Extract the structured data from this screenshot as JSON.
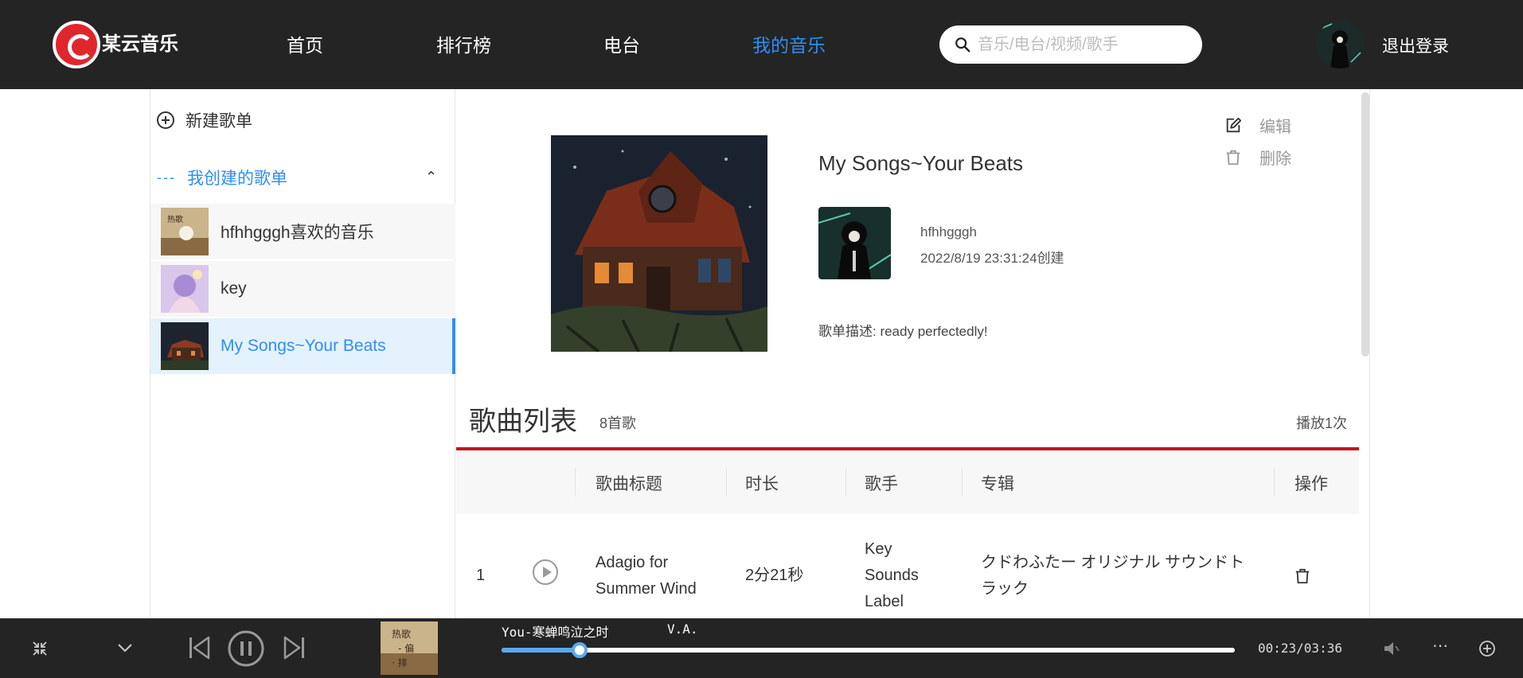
{
  "app": {
    "logo_text": "某云音乐"
  },
  "nav": [
    {
      "label": "首页",
      "active": false
    },
    {
      "label": "排行榜",
      "active": false
    },
    {
      "label": "电台",
      "active": false
    },
    {
      "label": "我的音乐",
      "active": true
    }
  ],
  "search": {
    "placeholder": "音乐/电台/视频/歌手",
    "value": ""
  },
  "user": {
    "logout_label": "退出登录"
  },
  "sidebar": {
    "new_playlist_label": "新建歌单",
    "group_label": "我创建的歌单",
    "items": [
      {
        "label": "hfhhgggh喜欢的音乐",
        "active": false
      },
      {
        "label": "key",
        "active": false
      },
      {
        "label": "My Songs~Your Beats",
        "active": true
      }
    ]
  },
  "playlist": {
    "title": "My Songs~Your Beats",
    "creator": "hfhhgggh",
    "created_at": "2022/8/19 23:31:24创建",
    "description": "歌单描述: ready perfectedly!",
    "edit_label": "编辑",
    "delete_label": "删除"
  },
  "songs": {
    "heading": "歌曲列表",
    "count_label": "8首歌",
    "plays_label": "播放1次",
    "columns": [
      "歌曲标题",
      "时长",
      "歌手",
      "专辑",
      "操作"
    ],
    "rows": [
      {
        "index": "1",
        "title": "Adagio for Summer Wind",
        "duration": "2分21秒",
        "artist": "Key Sounds Label",
        "album": "クドわふたー オリジナル サウンドトラック"
      }
    ]
  },
  "player": {
    "song": "You-寒蝉鸣泣之时",
    "artist": "V.A.",
    "time": "00:23/03:36",
    "progress": 0.106
  },
  "colors": {
    "accent": "#2f8ef5",
    "brand_red": "#c5141c",
    "topbar": "#242424"
  }
}
